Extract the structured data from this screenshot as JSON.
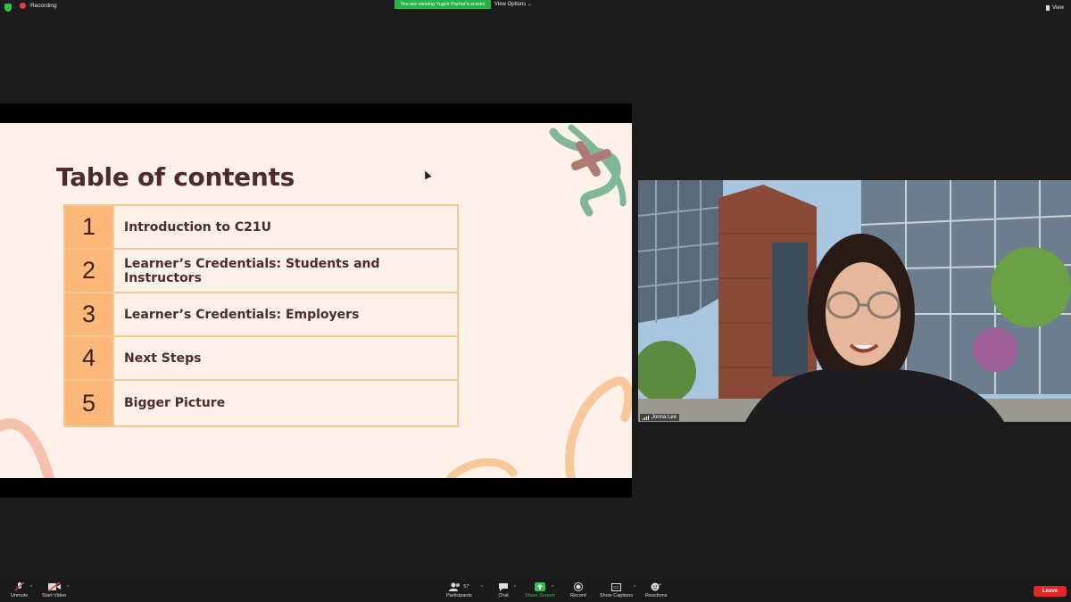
{
  "topbar": {
    "recording_label": "Recording",
    "viewing_banner": "You are viewing Yugvir Parhar's screen",
    "view_options_label": "View Options",
    "view_label": "View"
  },
  "slide": {
    "title": "Table of contents",
    "items": [
      {
        "num": "1",
        "text": "Introduction to C21U"
      },
      {
        "num": "2",
        "text": "Learner’s Credentials: Students and Instructors"
      },
      {
        "num": "3",
        "text": "Learner’s Credentials: Employers"
      },
      {
        "num": "4",
        "text": "Next Steps"
      },
      {
        "num": "5",
        "text": "Bigger Picture"
      }
    ],
    "colors": {
      "background": "#fdf1ea",
      "number_cell": "#fbb878",
      "border": "#f6c68f",
      "text": "#4e2b2b"
    }
  },
  "video": {
    "participant_name": "Jonna Lee"
  },
  "controls": {
    "unmute": "Unmute",
    "start_video": "Start Video",
    "participants": "Participants",
    "participant_count": "57",
    "chat": "Chat",
    "share_screen": "Share Screen",
    "record": "Record",
    "show_captions": "Show Captions",
    "reactions": "Reactions",
    "leave": "Leave",
    "cc_badge": "CC"
  }
}
